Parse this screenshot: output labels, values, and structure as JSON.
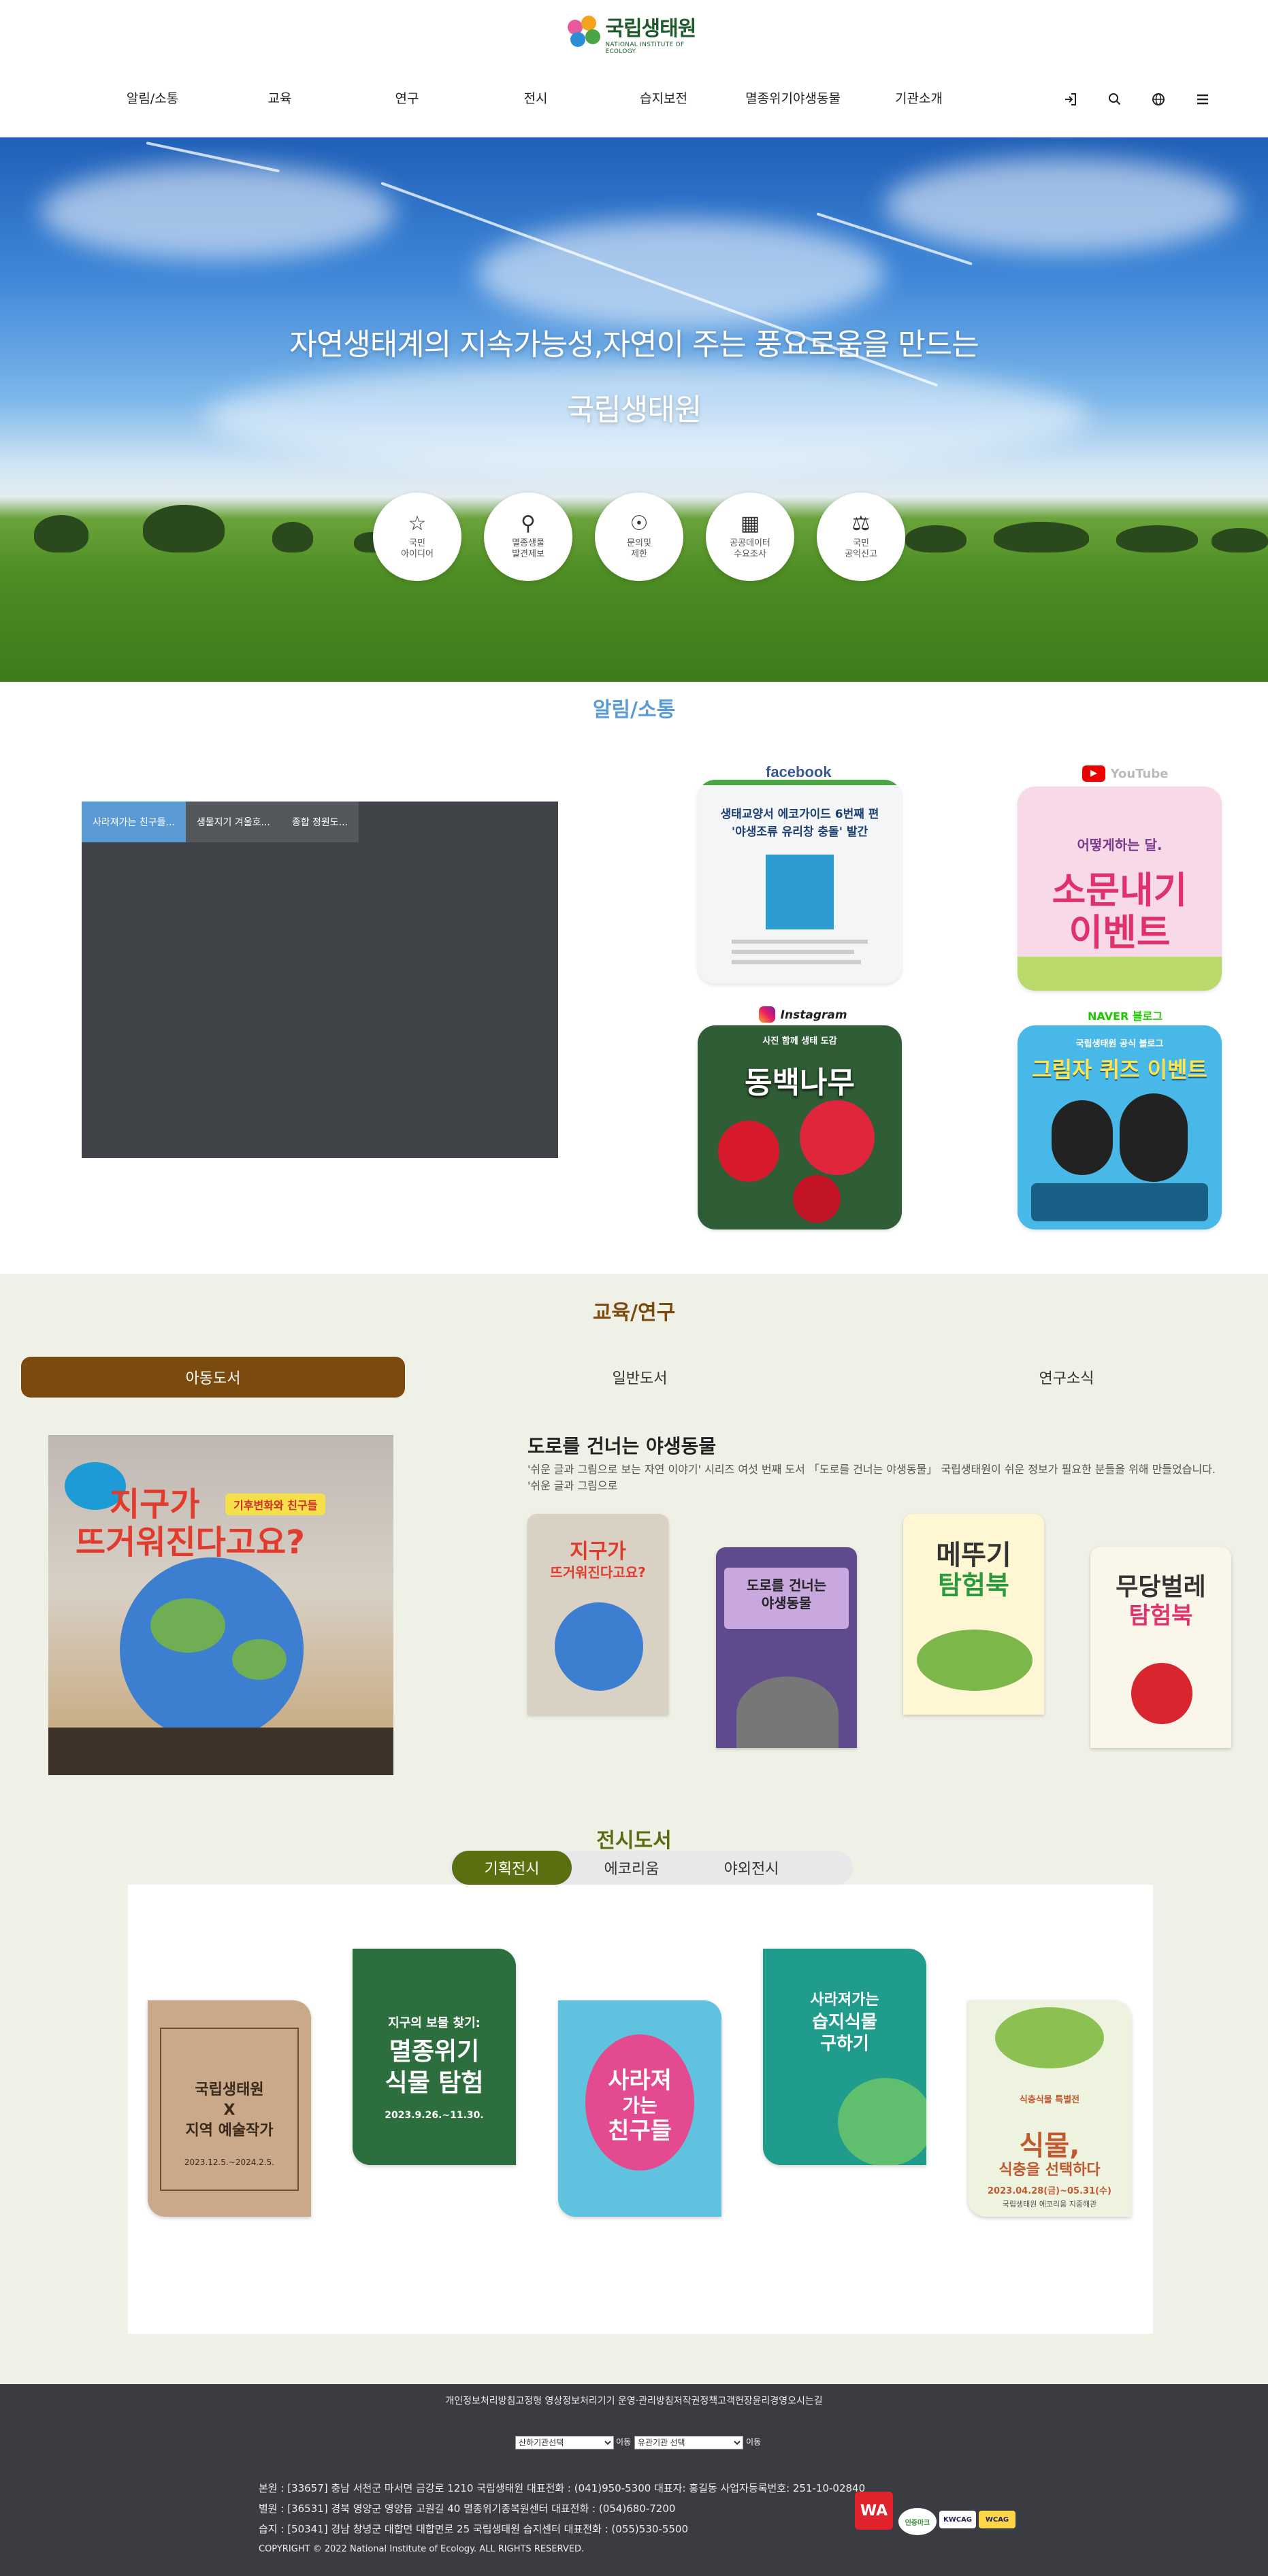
{
  "header": {
    "logo_title": "국립생태원",
    "logo_sub": "NATIONAL INSTITUTE OF ECOLOGY",
    "nav": [
      "알림/소통",
      "교육",
      "연구",
      "전시",
      "습지보전",
      "멸종위기야생동물",
      "기관소개"
    ],
    "utilities": [
      "login-icon",
      "search-icon",
      "globe-icon",
      "menu-icon"
    ]
  },
  "hero": {
    "title_line1": "자연생태계의 지속가능성,자연이 주는 풍요로움을 만드는",
    "title_line2": "국립생태원",
    "quick_links": [
      {
        "label": "국민\n아이디어",
        "icon": "people-idea-icon"
      },
      {
        "label": "멸종생물\n발견제보",
        "icon": "location-report-icon"
      },
      {
        "label": "문의및\n제한",
        "icon": "globe-inquiry-icon"
      },
      {
        "label": "공공데이터\n수요조사",
        "icon": "data-survey-icon"
      },
      {
        "label": "국민\n공익신고",
        "icon": "scale-report-icon"
      }
    ]
  },
  "notice": {
    "section_title": "알림/소통",
    "tabs": [
      "사라져가는 친구들...",
      "생물지기 겨울호...",
      "종합 정원도..."
    ],
    "sns": {
      "facebook_label": "facebook",
      "youtube_label": "YouTube",
      "instagram_label": "Instagram",
      "naver_label": "NAVER 블로그",
      "facebook_card": {
        "line1": "생태교양서 에코가이드 6번째 편",
        "line2": "'야생조류 유리창 충돌' 발간"
      },
      "youtube_card": {
        "top": "어떻게하는 달.",
        "line1": "소문내기",
        "line2": "이벤트"
      },
      "instagram_card": {
        "top": "사진 함께 생태 도감",
        "line1": "동백나무"
      },
      "naver_card": {
        "top": "국립생태원 공식 블로그",
        "line1": "그림자 퀴즈 이벤트"
      }
    }
  },
  "edu": {
    "section_title": "교육/연구",
    "tabs": [
      "아동도서",
      "일반도서",
      "연구소식"
    ],
    "big_book": {
      "title_line1": "지구가",
      "title_line2": "뜨거워진다고요?",
      "badge": "기후변화와 친구들"
    },
    "book_title": "도로를 건너는 야생동물",
    "book_desc_line1": "'쉬운 글과 그림으로 보는 자연 이야기' 시리즈 여섯 번째 도서 「도로를 건너는 야생동물」 국립생태원이 쉬운 정보가 필요한 분들을 위해 만들었습니다.",
    "book_desc_line2": "'쉬운 글과 그림으로",
    "thumbs": [
      {
        "line1": "지구가",
        "line2": "뜨거워진다고요?"
      },
      {
        "line1": "도로를 건너는",
        "line2": "야생동물"
      },
      {
        "line1": "메뚜기",
        "line2": "탐험북"
      },
      {
        "line1": "무당벌레",
        "line2": "탐험북"
      }
    ]
  },
  "exhibit": {
    "section_title": "전시도서",
    "tabs": [
      "기획전시",
      "에코리움",
      "야외전시"
    ],
    "posters": [
      {
        "line1": "국립생태원",
        "line2": "X",
        "line3": "지역 예술작가",
        "date": "2023.12.5.~2024.2.5."
      },
      {
        "line1": "지구의 보물 찾기:",
        "line2": "멸종위기",
        "line3": "식물 탐험",
        "date": "2023.9.26.~11.30."
      },
      {
        "line1": "사라져",
        "line2": "가는",
        "line3": "친구들",
        "date": ""
      },
      {
        "line1": "사라져가는",
        "line2": "습지식물",
        "line3": "구하기",
        "date": ""
      },
      {
        "line1": "식물,",
        "line2": "식충을 선택하다",
        "line3": "식충식물 특별전",
        "date": "2023.04.28(금)~05.31(수)",
        "venue": "국립생태원 에코리움 지중해관"
      }
    ]
  },
  "footer": {
    "links": "개인정보처리방침고정형 영상정보처리기기 운영·관리방침저작권정책고객헌장윤리경영오시는길",
    "select1": "산하기관선택",
    "select1_btn": "이동",
    "select2": "유관기관 선택",
    "select2_btn": "이동",
    "info": [
      "본원 : [33657] 충남 서천군 마서면 금강로 1210 국립생태원 대표전화 : (041)950-5300 대표자: 홍길동 사업자등록번호: 251-10-02840",
      "별원 : [36531] 경북 영양군 영양읍 고원길 40 멸종위기종복원센터 대표전화 : (054)680-7200",
      "습지 : [50341] 경남 창녕군 대합면 대합면로 25 국립생태원 습지센터 대표전화 : (055)530-5500",
      "COPYRIGHT © 2022 National Institute of Ecology. ALL RIGHTS RESERVED."
    ],
    "badges": [
      "WA",
      "인증마크",
      "KWCAG",
      "WCAG"
    ]
  },
  "colors": {
    "notice_title": "#5b9bd5",
    "edu_title": "#7a4a0f",
    "exhibit_title": "#5c6b10",
    "footer_bg": "#3a3c41",
    "edu_bg": "#eff0e6"
  }
}
